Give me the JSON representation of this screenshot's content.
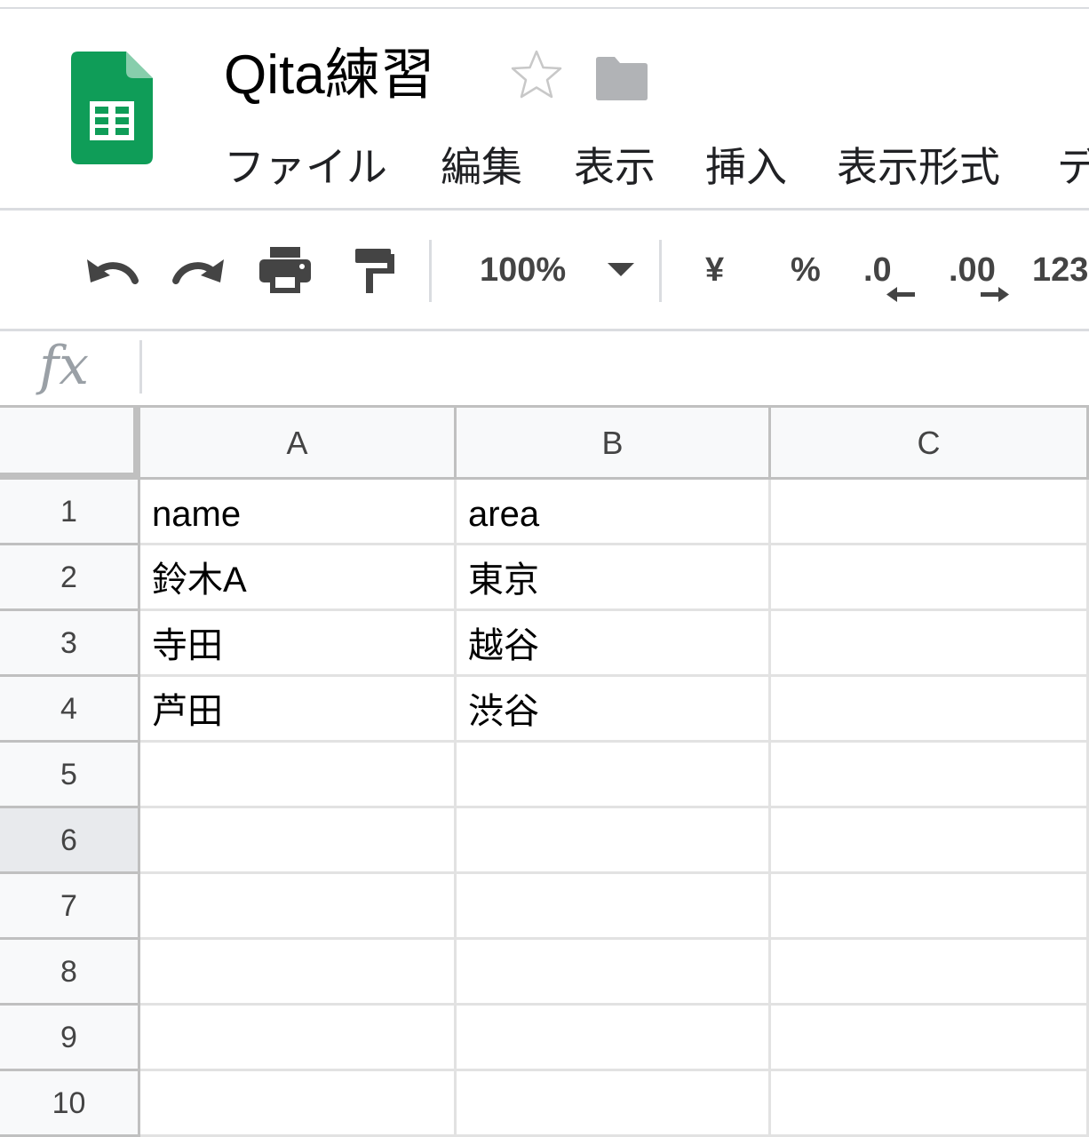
{
  "header": {
    "title": "Qita練習",
    "menu": [
      "ファイル",
      "編集",
      "表示",
      "挿入",
      "表示形式",
      "デ"
    ]
  },
  "toolbar": {
    "zoom": "100%",
    "currency": "¥",
    "percent": "%",
    "decrease_decimal": ".0",
    "increase_decimal": ".00",
    "more_formats": "123"
  },
  "formula_bar": {
    "label": "fx",
    "value": ""
  },
  "grid": {
    "columns": [
      "A",
      "B",
      "C"
    ],
    "rows": [
      {
        "num": "1",
        "cells": [
          "name",
          "area",
          ""
        ]
      },
      {
        "num": "2",
        "cells": [
          "鈴木A",
          "東京",
          ""
        ]
      },
      {
        "num": "3",
        "cells": [
          "寺田",
          "越谷",
          ""
        ]
      },
      {
        "num": "4",
        "cells": [
          "芦田",
          "渋谷",
          ""
        ]
      },
      {
        "num": "5",
        "cells": [
          "",
          "",
          ""
        ]
      },
      {
        "num": "6",
        "cells": [
          "",
          "",
          ""
        ]
      },
      {
        "num": "7",
        "cells": [
          "",
          "",
          ""
        ]
      },
      {
        "num": "8",
        "cells": [
          "",
          "",
          ""
        ]
      },
      {
        "num": "9",
        "cells": [
          "",
          "",
          ""
        ]
      },
      {
        "num": "10",
        "cells": [
          "",
          "",
          ""
        ]
      }
    ]
  },
  "colors": {
    "logo_green": "#0f9d58",
    "logo_fold": "#87ceac",
    "border": "#c0c0c0",
    "grid_line": "#e2e2e2",
    "header_bg": "#f8f9fa",
    "icon_gray": "#444444"
  },
  "icons": [
    "sheets-logo-icon",
    "star-icon",
    "folder-icon",
    "undo-icon",
    "redo-icon",
    "print-icon",
    "paint-format-icon",
    "dropdown-arrow-icon",
    "arrow-left-icon",
    "arrow-right-icon"
  ]
}
